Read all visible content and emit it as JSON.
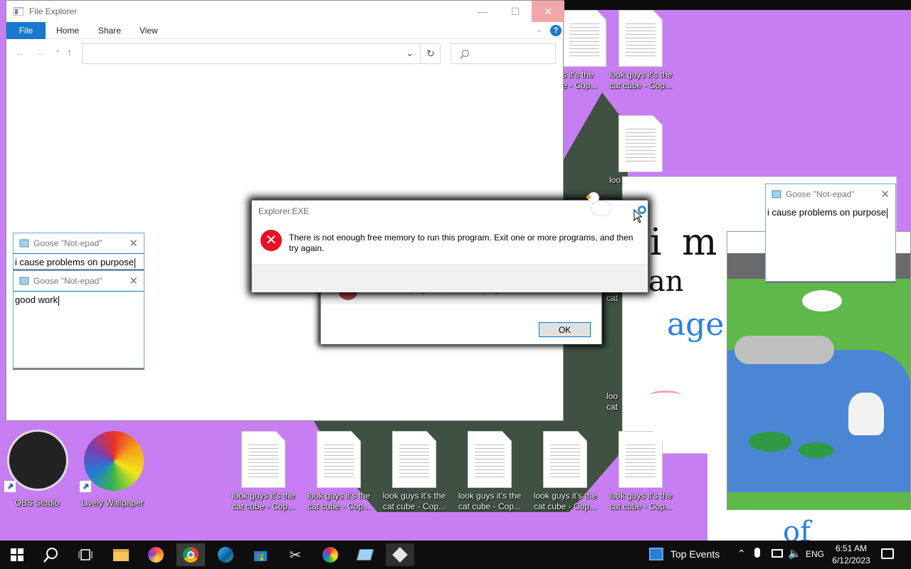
{
  "explorer": {
    "title": "File Explorer",
    "tabs": [
      "File",
      "Home",
      "Share",
      "View"
    ],
    "help_glyph": "?"
  },
  "error_dialog": {
    "title": "Explorer.EXE",
    "message": "There is not enough free memory to run this program. Exit one or more programs, and then try again.",
    "behind_partial_text": "one or more programs, and then try again.",
    "ok_label": "OK"
  },
  "goose_notes": [
    {
      "title": "Goose \"Not-epad\"",
      "text": "i cause problems on purpose"
    },
    {
      "title": "Goose \"Not-epad\"",
      "text": "good work"
    },
    {
      "title": "Goose \"Not-epad\"",
      "text": "i cause problems on purpose"
    }
  ],
  "desktop": {
    "apps": [
      {
        "label": "OBS Studio",
        "icon": "obs-icon"
      },
      {
        "label": "Lively Wallpaper",
        "icon": "lively-wallpaper-icon"
      }
    ],
    "file_label": "look guys it's the cat cube - Cop...",
    "file_label_partial_left": "s it's the\ne - Cop...",
    "file_label_partial_mid": "loo",
    "file_label_cat": "cat",
    "file_label_lo_cat": "loo\ncat"
  },
  "drawing": {
    "lines": [
      "i m",
      "an",
      "age",
      "of"
    ]
  },
  "taskbar": {
    "news_label": "Top Events",
    "language": "ENG",
    "time": "6:51 AM",
    "date": "6/12/2023"
  },
  "colors": {
    "wallpaper": "#c77ef3",
    "accent": "#0078d7",
    "error_red": "#e81123",
    "taskbar": "#0e0e0e"
  }
}
